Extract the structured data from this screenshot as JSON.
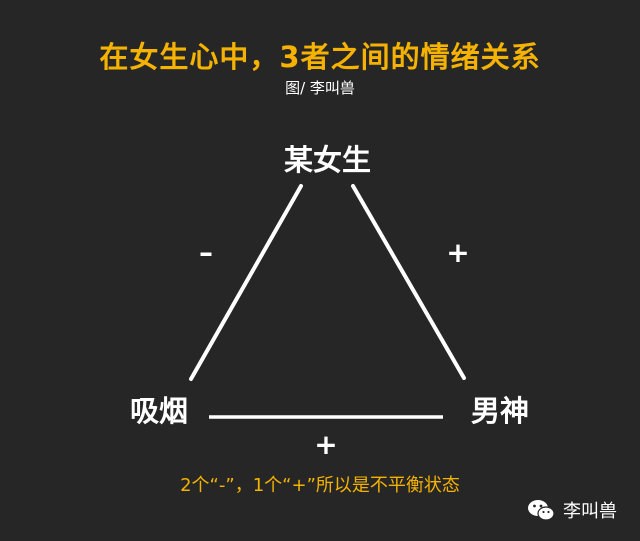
{
  "header": {
    "title": "在女生心中，3者之间的情绪关系",
    "credit": "图/ 李叫兽"
  },
  "nodes": {
    "top": "某女生",
    "bottom_left": "吸烟",
    "bottom_right": "男神"
  },
  "edges": {
    "left_sign": "–",
    "right_sign": "+",
    "bottom_sign": "+"
  },
  "caption": "2个“-”，1个“+”所以是不平衡状态",
  "watermark": {
    "icon": "wechat-icon",
    "text": "李叫兽"
  },
  "colors": {
    "background": "#262626",
    "title": "#f5b200",
    "lines": "#ffffff",
    "caption": "#f5b200"
  }
}
